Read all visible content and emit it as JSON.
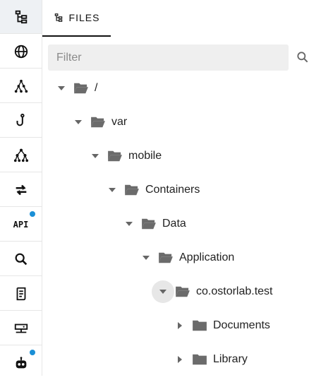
{
  "rail": {
    "items": [
      {
        "name": "files-tree-icon",
        "active": true,
        "dot": false
      },
      {
        "name": "globe-icon",
        "active": false,
        "dot": false
      },
      {
        "name": "graph-icon",
        "active": false,
        "dot": false
      },
      {
        "name": "hook-icon",
        "active": false,
        "dot": false
      },
      {
        "name": "hierarchy-icon",
        "active": false,
        "dot": false
      },
      {
        "name": "transfer-icon",
        "active": false,
        "dot": false
      },
      {
        "name": "api-icon",
        "active": false,
        "dot": true,
        "label": "API"
      },
      {
        "name": "search-icon",
        "active": false,
        "dot": false
      },
      {
        "name": "document-icon",
        "active": false,
        "dot": false
      },
      {
        "name": "server-icon",
        "active": false,
        "dot": false
      },
      {
        "name": "robot-icon",
        "active": false,
        "dot": true
      }
    ]
  },
  "tab": {
    "label": "FILES"
  },
  "filter": {
    "placeholder": "Filter"
  },
  "tree": [
    {
      "label": "/",
      "state": "expanded"
    },
    {
      "label": "var",
      "state": "expanded"
    },
    {
      "label": "mobile",
      "state": "expanded"
    },
    {
      "label": "Containers",
      "state": "expanded"
    },
    {
      "label": "Data",
      "state": "expanded"
    },
    {
      "label": "Application",
      "state": "expanded"
    },
    {
      "label": "co.ostorlab.test",
      "state": "expanded",
      "highlighted": true
    },
    {
      "label": "Documents",
      "state": "collapsed"
    },
    {
      "label": "Library",
      "state": "collapsed"
    }
  ],
  "colors": {
    "accent": "#1a8fd6",
    "folder": "#6b6b6b",
    "rail_active": "#eef1f4"
  }
}
